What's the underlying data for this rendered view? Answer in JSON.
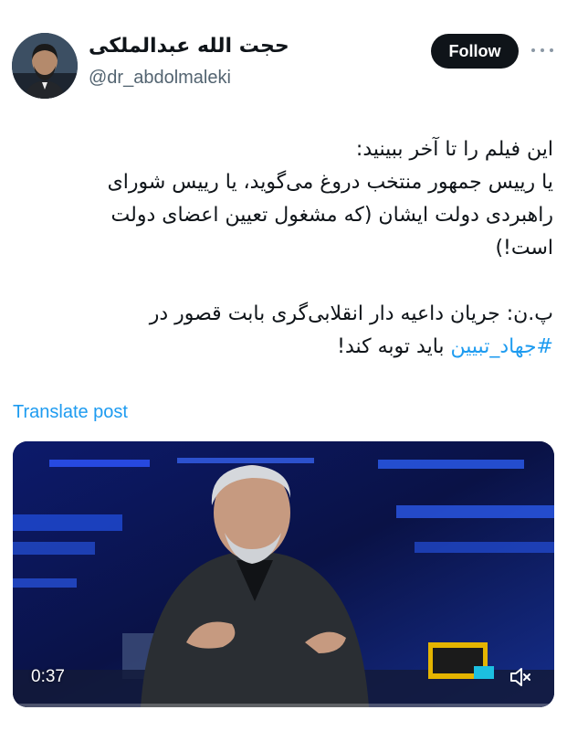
{
  "author": {
    "display_name": "حجت الله عبدالملکی",
    "handle": "@dr_abdolmaleki"
  },
  "header": {
    "follow_label": "Follow",
    "more_icon": "more-horizontal-icon"
  },
  "tweet": {
    "lines": [
      "این فیلم را تا آخر ببینید:",
      "یا رییس جمهور منتخب دروغ می‌گوید، یا رییس شورای",
      "راهبردی دولت ایشان (که مشغول تعیین اعضای دولت",
      "است!)"
    ],
    "ps_line1": "پ.ن: جریان داعیه دار انقلابی‌گری بابت قصور در",
    "ps_hashtag": "#جهاد_تبیین",
    "ps_line2_rest": " باید توبه کند!"
  },
  "translate_label": "Translate post",
  "video": {
    "duration": "0:37",
    "mute_icon": "volume-muted-icon",
    "progress": 0.0
  },
  "colors": {
    "accent": "#1d9bf0",
    "text": "#0f1419",
    "secondary": "#536471"
  }
}
